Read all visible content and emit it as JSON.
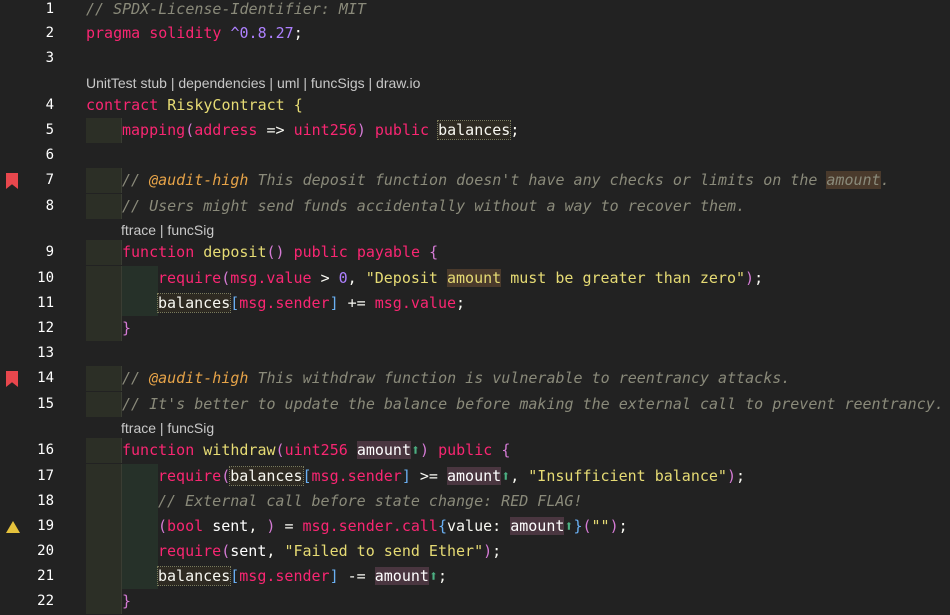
{
  "editor": {
    "lines": [
      {
        "n": "1"
      },
      {
        "n": "2"
      },
      {
        "n": "3"
      },
      {
        "n": "4"
      },
      {
        "n": "5"
      },
      {
        "n": "6"
      },
      {
        "n": "7"
      },
      {
        "n": "8"
      },
      {
        "n": "9"
      },
      {
        "n": "10"
      },
      {
        "n": "11"
      },
      {
        "n": "12"
      },
      {
        "n": "13"
      },
      {
        "n": "14"
      },
      {
        "n": "15"
      },
      {
        "n": "16"
      },
      {
        "n": "17"
      },
      {
        "n": "18"
      },
      {
        "n": "19"
      },
      {
        "n": "20"
      },
      {
        "n": "21"
      },
      {
        "n": "22"
      }
    ],
    "code_lens": {
      "contract": "UnitTest stub | dependencies | uml | funcSigs | draw.io",
      "deposit": "ftrace | funcSig",
      "withdraw": "ftrace | funcSig"
    },
    "tokens": {
      "l1": "// SPDX-License-Identifier: MIT",
      "pragma": "pragma",
      "solidity": "solidity",
      "version": "^0.8.27",
      "semi": ";",
      "contract_kw": "contract",
      "contract_name": "RiskyContract",
      "lbrace": "{",
      "rbrace": "}",
      "mapping": "mapping",
      "lparen": "(",
      "rparen": ")",
      "address": "address",
      "arrow_op": "=>",
      "uint256": "uint256",
      "public": "public",
      "balances": "balances",
      "c7_prefix": "// ",
      "c7_tag": "@audit-high",
      "c7_text": " This deposit function doesn't have any checks or limits on the ",
      "c7_amount": "amount",
      "c7_end": ".",
      "c8": "// Users might send funds accidentally without a way to recover them.",
      "function": "function",
      "deposit": "deposit",
      "payable": "payable",
      "require": "require",
      "msg_value": "msg.value",
      "gt": ">",
      "zero": "0",
      "comma": ",",
      "str10_a": "\"Deposit ",
      "str10_amount": "amount",
      "str10_b": " must be greater than zero\"",
      "lbracket": "[",
      "rbracket": "]",
      "msg_sender": "msg.sender",
      "plus_eq": "+=",
      "minus_eq": "-=",
      "c14_prefix": "// ",
      "c14_tag": "@audit-high",
      "c14_text": " This withdraw function is vulnerable to reentrancy attacks.",
      "c15": "// It's better to update the balance before making the external call to prevent reentrancy.",
      "withdraw": "withdraw",
      "amount": "amount",
      "up_arrow": "⬆",
      "gte": ">=",
      "str17": "\"Insufficient balance\"",
      "c18": "// External call before state change: RED FLAG!",
      "bool": "bool",
      "sent": "sent",
      "eq": "=",
      "call": "msg.sender.call",
      "value_key": "value:",
      "empty_str": "\"\"",
      "str20": "\"Failed to send Ether\""
    },
    "gutter_icons": {
      "l7": "bookmark-icon",
      "l14": "bookmark-icon",
      "l19": "warning-icon"
    }
  }
}
